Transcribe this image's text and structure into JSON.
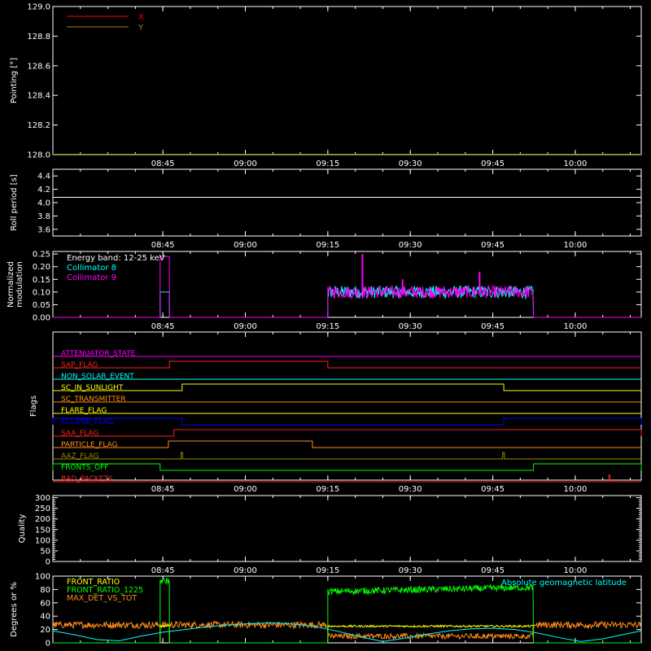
{
  "time_ticks": [
    "08:45",
    "09:00",
    "09:15",
    "09:30",
    "09:45",
    "10:00"
  ],
  "time_tick_minutes": [
    45,
    60,
    75,
    90,
    105,
    120
  ],
  "time_range_minutes": [
    25,
    132
  ],
  "colors": {
    "X": "#ff0000",
    "Y": "#9a8a00",
    "cyan": "#00ffff",
    "magenta": "#ff00ff",
    "green": "#00ff00",
    "yellow": "#ffff00",
    "orange": "#ff8c1a",
    "white": "#ffffff"
  },
  "chart_data": [
    {
      "type": "line",
      "ylabel": "Pointing [°]",
      "ylim": [
        128.0,
        129.0
      ],
      "yticks": [
        "129.0",
        "128.8",
        "128.6",
        "128.4",
        "128.2",
        "128.0"
      ],
      "yticks_values": [
        129.0,
        128.8,
        128.6,
        128.4,
        128.2,
        128.0
      ],
      "series": [
        {
          "name": "X",
          "color": "#ff0000",
          "x": [
            25,
            132
          ],
          "values": [
            128.0,
            128.0
          ]
        },
        {
          "name": "Y",
          "color": "#9a8a00",
          "x": [
            25,
            132
          ],
          "values": [
            128.0,
            128.0
          ]
        }
      ]
    },
    {
      "type": "line",
      "ylabel": "Roll period [s]",
      "ylim": [
        3.5,
        4.5
      ],
      "yticks": [
        "4.4",
        "4.2",
        "4.0",
        "3.8",
        "3.6"
      ],
      "yticks_values": [
        4.4,
        4.2,
        4.0,
        3.8,
        3.6
      ],
      "series": [
        {
          "color": "#ffffff",
          "x": [
            25,
            132
          ],
          "values": [
            4.08,
            4.08
          ]
        }
      ]
    },
    {
      "type": "line",
      "ylabel_lines": [
        "Normalized",
        "modulation"
      ],
      "ylim": [
        0.0,
        0.26
      ],
      "yticks": [
        "0.25",
        "0.20",
        "0.15",
        "0.10",
        "0.05",
        "0.00"
      ],
      "yticks_values": [
        0.25,
        0.2,
        0.15,
        0.1,
        0.05,
        0.0
      ],
      "legend": [
        "Energy band: 12-25 keV",
        "Collimator 8",
        "Collimator 9"
      ],
      "legend_colors": [
        "#ffffff",
        "#00ffff",
        "#ff00ff"
      ],
      "series": [
        {
          "name": "Collimator 8",
          "color": "#00ffff",
          "segments": [
            [
              44.5,
              46.2,
              0.1
            ],
            [
              75.0,
              112.4,
              0.1
            ]
          ]
        },
        {
          "name": "Collimator 9",
          "color": "#ff00ff",
          "segments": [
            [
              44.5,
              46.2,
              0.24
            ],
            [
              75.0,
              112.4,
              0.1
            ]
          ],
          "peaks": [
            [
              81.3,
              0.25
            ],
            [
              102.6,
              0.18
            ],
            [
              88.6,
              0.15
            ]
          ]
        }
      ]
    },
    {
      "type": "flags",
      "ylabel": "Flags",
      "flags": [
        {
          "name": "ATTENUATOR_STATE",
          "color": "#ff00ff",
          "on": []
        },
        {
          "name": "SAP_FLAG",
          "color": "#ff2020",
          "on": [
            [
              46.2,
              75.0
            ]
          ]
        },
        {
          "name": "NON_SOLAR_EVENT",
          "color": "#00ffff",
          "on": []
        },
        {
          "name": "SC_IN_SUNLIGHT",
          "color": "#ffff00",
          "on": [
            [
              48.5,
              107.0
            ]
          ]
        },
        {
          "name": "SC_TRANSMITTER",
          "color": "#ff8c1a",
          "on": []
        },
        {
          "name": "FLARE_FLAG",
          "color": "#ffff00",
          "on": []
        },
        {
          "name": "ECLIPSE_FLAG",
          "color": "#0000ff",
          "on": [
            [
              25,
              48.5
            ],
            [
              107.0,
              132
            ]
          ]
        },
        {
          "name": "SAA_FLAG",
          "color": "#ff2020",
          "on": [
            [
              47.0,
              132
            ]
          ]
        },
        {
          "name": "PARTICLE_FLAG",
          "color": "#ff8c1a",
          "on": [
            [
              46.0,
              72.2
            ]
          ]
        },
        {
          "name": "AAZ_FLAG",
          "color": "#9a8a00",
          "on": [
            [
              48.3,
              48.6
            ],
            [
              106.8,
              107.1
            ]
          ]
        },
        {
          "name": "FRONTS_OFF",
          "color": "#00ff00",
          "on": [
            [
              25,
              44.5
            ],
            [
              112.4,
              132
            ]
          ]
        },
        {
          "name": "BAD_PACKETS",
          "color": "#ff2020",
          "on": [
            [
              126.1,
              126.3
            ]
          ]
        }
      ]
    },
    {
      "type": "line",
      "ylabel": "Quality",
      "ylim": [
        0,
        310
      ],
      "yticks": [
        "300",
        "250",
        "200",
        "150",
        "100",
        "50",
        "0"
      ],
      "yticks_values": [
        300,
        250,
        200,
        150,
        100,
        50,
        0
      ],
      "series": []
    },
    {
      "type": "line",
      "ylabel": "Degrees or %",
      "ylim": [
        0,
        100
      ],
      "yticks": [
        "100",
        "80",
        "60",
        "40",
        "20",
        "0"
      ],
      "yticks_values": [
        100,
        80,
        60,
        40,
        20,
        0
      ],
      "legend": [
        "FRONT_RATIO",
        "FRONT_RATIO_1225",
        "MAX_DET_VS_TOT"
      ],
      "legend_colors": [
        "#ffff00",
        "#00ff00",
        "#ff8c1a"
      ],
      "annotation": "Absolute geomagnetic latitude",
      "series": [
        {
          "name": "FRONT_RATIO",
          "color": "#ffff00",
          "segments": [
            [
              44.5,
              46.2,
              25
            ],
            [
              75.0,
              112.4,
              25
            ]
          ]
        },
        {
          "name": "FRONT_RATIO_1225",
          "color": "#00ff00",
          "segments": [
            [
              44.5,
              46.2,
              93
            ],
            [
              75.0,
              112.4,
              77
            ]
          ]
        },
        {
          "name": "MAX_DET_VS_TOT",
          "color": "#ff8c1a",
          "baseline": 27
        },
        {
          "name": "Absolute geomagnetic latitude",
          "color": "#00ffff",
          "x": [
            25,
            29,
            33,
            37,
            41,
            45,
            49,
            53,
            57,
            61,
            65,
            69,
            73,
            77,
            81,
            85,
            89,
            93,
            97,
            101,
            105,
            109,
            113,
            117,
            121,
            125,
            129,
            132
          ],
          "values": [
            18,
            12,
            5,
            3,
            10,
            16,
            20,
            24,
            27,
            29,
            30,
            28,
            24,
            17,
            9,
            2,
            7,
            13,
            18,
            21,
            22,
            20,
            15,
            8,
            2,
            6,
            13,
            18
          ]
        }
      ]
    }
  ]
}
